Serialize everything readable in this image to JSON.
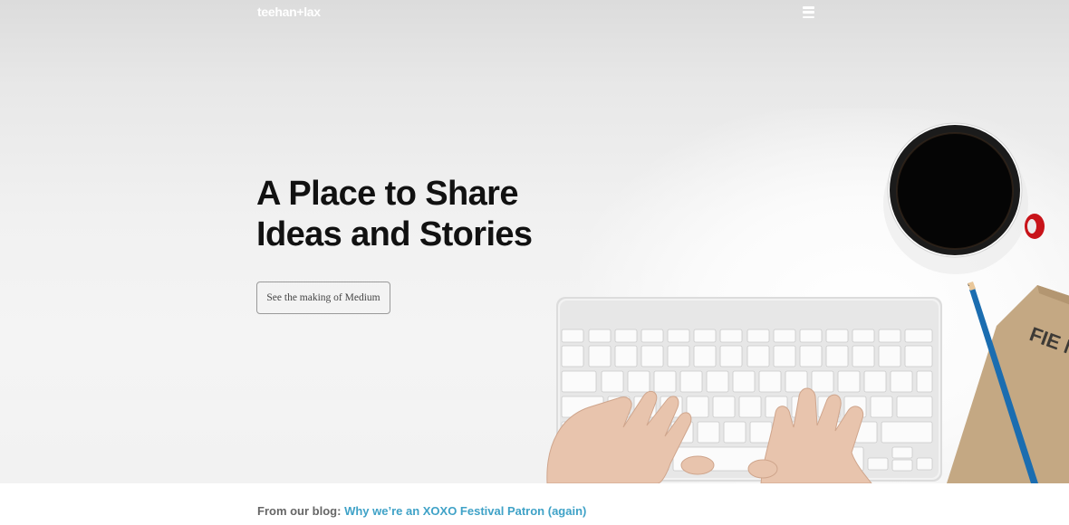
{
  "header": {
    "logo_text": "teehan+lax",
    "menu_icon": "hamburger-menu-icon"
  },
  "hero": {
    "headline_line1": "A Place to Share",
    "headline_line2": "Ideas and Stories",
    "cta_label": "See the making of Medium",
    "image_description_icons": [
      "coffee-cup-icon",
      "keyboard-icon",
      "hands-icon",
      "notebook-icon",
      "pencil-icon"
    ],
    "notebook_text": "FIE NOT"
  },
  "blog": {
    "label": "From our blog:",
    "link_text": "Why we’re an XOXO Festival Patron (again)"
  },
  "colors": {
    "link": "#3fa2c7",
    "headline": "#111111",
    "hero_bg": "#f2f2f2"
  }
}
